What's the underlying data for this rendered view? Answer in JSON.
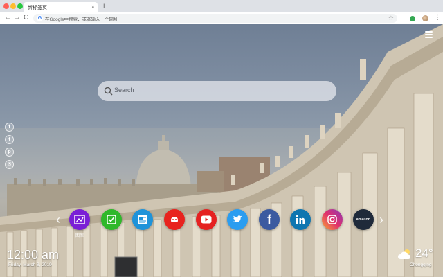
{
  "browser": {
    "tab_title": "新标签页",
    "tab_close": "×",
    "new_tab": "+",
    "address_placeholder": "在Google中搜索，或者输入一个网址",
    "google_letter": "G",
    "back": "←",
    "forward": "→",
    "reload": "C",
    "star": "☆",
    "menu": "⋮"
  },
  "search": {
    "placeholder": "Search"
  },
  "social_icons": [
    {
      "name": "facebook-icon",
      "glyph": "f"
    },
    {
      "name": "twitter-icon",
      "glyph": "t"
    },
    {
      "name": "pinterest-icon",
      "glyph": "p"
    },
    {
      "name": "link-icon",
      "glyph": "✉"
    }
  ],
  "carousel": {
    "prev": "‹",
    "next": "›"
  },
  "speed_dials": [
    {
      "name": "gallery-dial",
      "label": "图库",
      "color": "#7a1fd6"
    },
    {
      "name": "checkbox-dial",
      "label": "",
      "color": "#2fb82a"
    },
    {
      "name": "news-dial",
      "label": "",
      "color": "#1f93d9"
    },
    {
      "name": "game-dial",
      "label": "",
      "color": "#e8231e"
    },
    {
      "name": "youtube-dial",
      "label": "",
      "color": "#e52121"
    },
    {
      "name": "twitter-dial",
      "label": "",
      "color": "#2b9df0"
    },
    {
      "name": "facebook-dial",
      "label": "",
      "color": "#3b5aa0"
    },
    {
      "name": "linkedin-dial",
      "label": "",
      "color": "#0e76b0"
    },
    {
      "name": "instagram-dial",
      "label": "",
      "color": "#d6307a"
    },
    {
      "name": "amazon-dial",
      "label": "amazon",
      "color": "#1f2a3a"
    }
  ],
  "clock": {
    "time": "12:00 am",
    "date": "Friday, March 8, 2019"
  },
  "weather": {
    "temperature": "24°",
    "city": "Chongqing"
  }
}
